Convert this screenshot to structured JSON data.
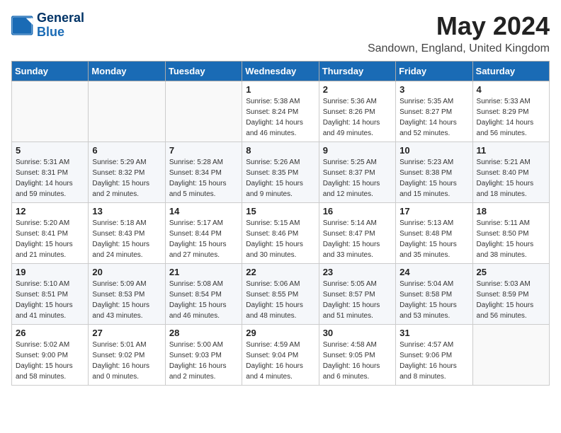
{
  "header": {
    "logo_line1": "General",
    "logo_line2": "Blue",
    "month_title": "May 2024",
    "subtitle": "Sandown, England, United Kingdom"
  },
  "weekdays": [
    "Sunday",
    "Monday",
    "Tuesday",
    "Wednesday",
    "Thursday",
    "Friday",
    "Saturday"
  ],
  "weeks": [
    [
      {
        "day": "",
        "info": ""
      },
      {
        "day": "",
        "info": ""
      },
      {
        "day": "",
        "info": ""
      },
      {
        "day": "1",
        "info": "Sunrise: 5:38 AM\nSunset: 8:24 PM\nDaylight: 14 hours\nand 46 minutes."
      },
      {
        "day": "2",
        "info": "Sunrise: 5:36 AM\nSunset: 8:26 PM\nDaylight: 14 hours\nand 49 minutes."
      },
      {
        "day": "3",
        "info": "Sunrise: 5:35 AM\nSunset: 8:27 PM\nDaylight: 14 hours\nand 52 minutes."
      },
      {
        "day": "4",
        "info": "Sunrise: 5:33 AM\nSunset: 8:29 PM\nDaylight: 14 hours\nand 56 minutes."
      }
    ],
    [
      {
        "day": "5",
        "info": "Sunrise: 5:31 AM\nSunset: 8:31 PM\nDaylight: 14 hours\nand 59 minutes."
      },
      {
        "day": "6",
        "info": "Sunrise: 5:29 AM\nSunset: 8:32 PM\nDaylight: 15 hours\nand 2 minutes."
      },
      {
        "day": "7",
        "info": "Sunrise: 5:28 AM\nSunset: 8:34 PM\nDaylight: 15 hours\nand 5 minutes."
      },
      {
        "day": "8",
        "info": "Sunrise: 5:26 AM\nSunset: 8:35 PM\nDaylight: 15 hours\nand 9 minutes."
      },
      {
        "day": "9",
        "info": "Sunrise: 5:25 AM\nSunset: 8:37 PM\nDaylight: 15 hours\nand 12 minutes."
      },
      {
        "day": "10",
        "info": "Sunrise: 5:23 AM\nSunset: 8:38 PM\nDaylight: 15 hours\nand 15 minutes."
      },
      {
        "day": "11",
        "info": "Sunrise: 5:21 AM\nSunset: 8:40 PM\nDaylight: 15 hours\nand 18 minutes."
      }
    ],
    [
      {
        "day": "12",
        "info": "Sunrise: 5:20 AM\nSunset: 8:41 PM\nDaylight: 15 hours\nand 21 minutes."
      },
      {
        "day": "13",
        "info": "Sunrise: 5:18 AM\nSunset: 8:43 PM\nDaylight: 15 hours\nand 24 minutes."
      },
      {
        "day": "14",
        "info": "Sunrise: 5:17 AM\nSunset: 8:44 PM\nDaylight: 15 hours\nand 27 minutes."
      },
      {
        "day": "15",
        "info": "Sunrise: 5:15 AM\nSunset: 8:46 PM\nDaylight: 15 hours\nand 30 minutes."
      },
      {
        "day": "16",
        "info": "Sunrise: 5:14 AM\nSunset: 8:47 PM\nDaylight: 15 hours\nand 33 minutes."
      },
      {
        "day": "17",
        "info": "Sunrise: 5:13 AM\nSunset: 8:48 PM\nDaylight: 15 hours\nand 35 minutes."
      },
      {
        "day": "18",
        "info": "Sunrise: 5:11 AM\nSunset: 8:50 PM\nDaylight: 15 hours\nand 38 minutes."
      }
    ],
    [
      {
        "day": "19",
        "info": "Sunrise: 5:10 AM\nSunset: 8:51 PM\nDaylight: 15 hours\nand 41 minutes."
      },
      {
        "day": "20",
        "info": "Sunrise: 5:09 AM\nSunset: 8:53 PM\nDaylight: 15 hours\nand 43 minutes."
      },
      {
        "day": "21",
        "info": "Sunrise: 5:08 AM\nSunset: 8:54 PM\nDaylight: 15 hours\nand 46 minutes."
      },
      {
        "day": "22",
        "info": "Sunrise: 5:06 AM\nSunset: 8:55 PM\nDaylight: 15 hours\nand 48 minutes."
      },
      {
        "day": "23",
        "info": "Sunrise: 5:05 AM\nSunset: 8:57 PM\nDaylight: 15 hours\nand 51 minutes."
      },
      {
        "day": "24",
        "info": "Sunrise: 5:04 AM\nSunset: 8:58 PM\nDaylight: 15 hours\nand 53 minutes."
      },
      {
        "day": "25",
        "info": "Sunrise: 5:03 AM\nSunset: 8:59 PM\nDaylight: 15 hours\nand 56 minutes."
      }
    ],
    [
      {
        "day": "26",
        "info": "Sunrise: 5:02 AM\nSunset: 9:00 PM\nDaylight: 15 hours\nand 58 minutes."
      },
      {
        "day": "27",
        "info": "Sunrise: 5:01 AM\nSunset: 9:02 PM\nDaylight: 16 hours\nand 0 minutes."
      },
      {
        "day": "28",
        "info": "Sunrise: 5:00 AM\nSunset: 9:03 PM\nDaylight: 16 hours\nand 2 minutes."
      },
      {
        "day": "29",
        "info": "Sunrise: 4:59 AM\nSunset: 9:04 PM\nDaylight: 16 hours\nand 4 minutes."
      },
      {
        "day": "30",
        "info": "Sunrise: 4:58 AM\nSunset: 9:05 PM\nDaylight: 16 hours\nand 6 minutes."
      },
      {
        "day": "31",
        "info": "Sunrise: 4:57 AM\nSunset: 9:06 PM\nDaylight: 16 hours\nand 8 minutes."
      },
      {
        "day": "",
        "info": ""
      }
    ]
  ]
}
